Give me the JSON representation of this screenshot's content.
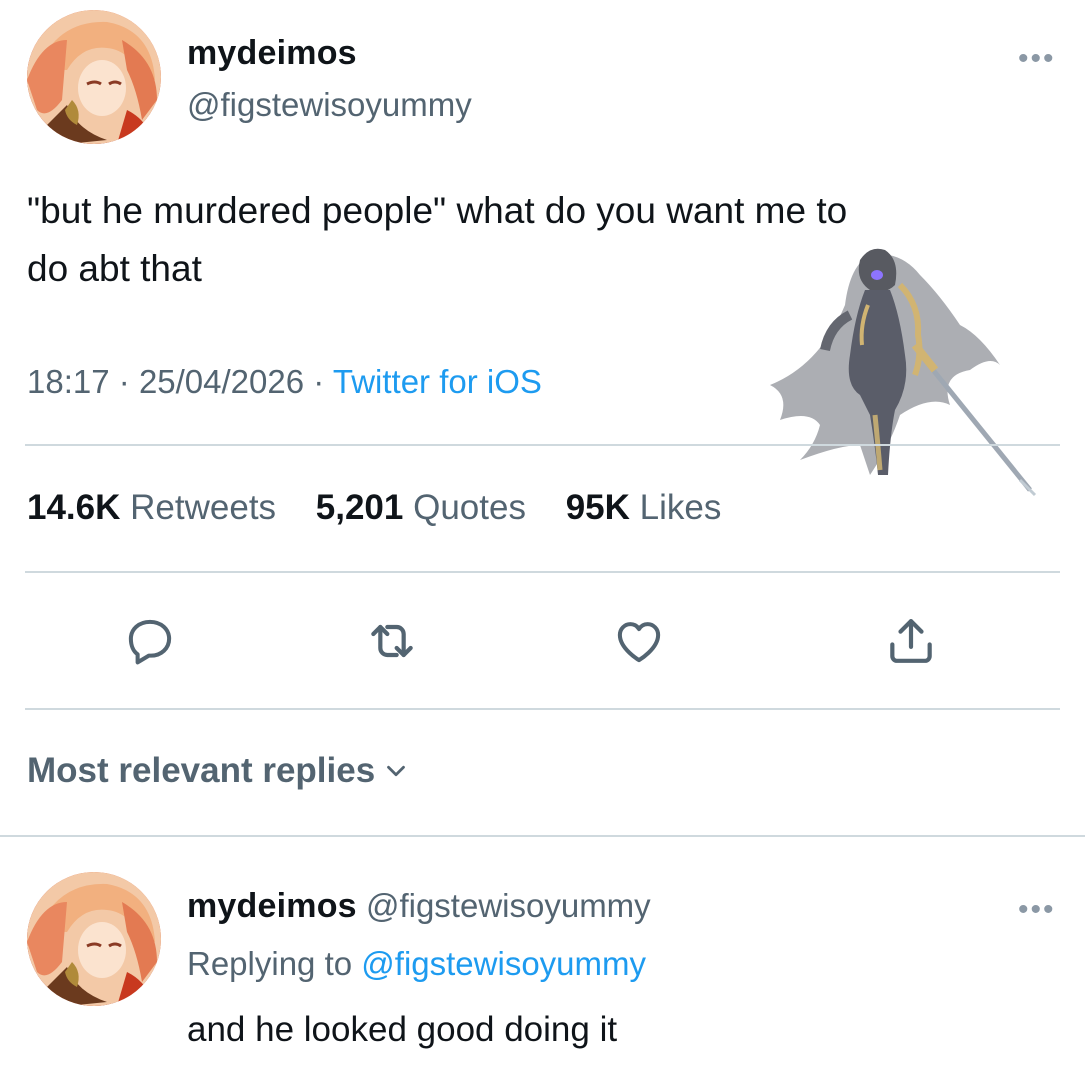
{
  "tweet": {
    "author_name": "mydeimos",
    "author_handle": "@figstewisoyummy",
    "more_icon": "more-horizontal-icon",
    "text_line1": "\"but he murdered people\" what do you want me to",
    "text_line2": "do abt that",
    "time": "18:17",
    "date": "25/04/2026",
    "separator": "·",
    "source": "Twitter for iOS"
  },
  "stats": {
    "retweets_count": "14.6K",
    "retweets_label": "Retweets",
    "quotes_count": "5,201",
    "quotes_label": "Quotes",
    "likes_count": "95K",
    "likes_label": "Likes"
  },
  "actions": {
    "reply_icon": "reply-icon",
    "retweet_icon": "retweet-icon",
    "like_icon": "heart-icon",
    "share_icon": "share-icon"
  },
  "replies_sort": {
    "label": "Most relevant replies",
    "icon": "chevron-down-icon"
  },
  "reply": {
    "author_name": "mydeimos",
    "author_handle": "@figstewisoyummy",
    "replying_label": "Replying to",
    "replying_to": "@figstewisoyummy",
    "text": "and he looked good doing it"
  },
  "colors": {
    "text": "#0f1419",
    "secondary": "#536471",
    "accent": "#1d9bf0",
    "divider": "#cfd9de"
  }
}
